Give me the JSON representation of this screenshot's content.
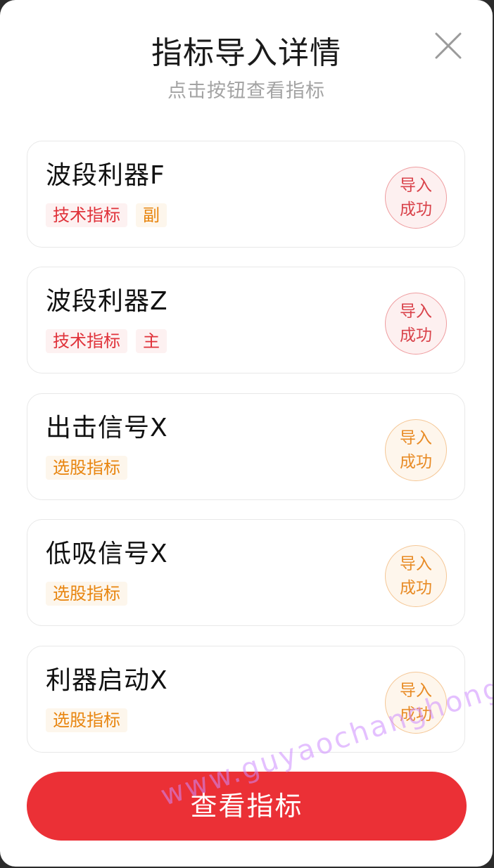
{
  "modal": {
    "title": "指标导入详情",
    "subtitle": "点击按钮查看指标"
  },
  "icons": {
    "close": "close-icon"
  },
  "colors": {
    "primary_red": "#eb3036",
    "tag_red": "#e0323a",
    "tag_orange": "#e8850f"
  },
  "indicators": [
    {
      "name": "波段利器F",
      "tags": [
        {
          "label": "技术指标",
          "tone": "red"
        },
        {
          "label": "副",
          "tone": "orange"
        }
      ],
      "status_line1": "导入",
      "status_line2": "成功",
      "status_tone": "red"
    },
    {
      "name": "波段利器Z",
      "tags": [
        {
          "label": "技术指标",
          "tone": "red"
        },
        {
          "label": "主",
          "tone": "red"
        }
      ],
      "status_line1": "导入",
      "status_line2": "成功",
      "status_tone": "red"
    },
    {
      "name": "出击信号X",
      "tags": [
        {
          "label": "选股指标",
          "tone": "orange"
        }
      ],
      "status_line1": "导入",
      "status_line2": "成功",
      "status_tone": "orange"
    },
    {
      "name": "低吸信号X",
      "tags": [
        {
          "label": "选股指标",
          "tone": "orange"
        }
      ],
      "status_line1": "导入",
      "status_line2": "成功",
      "status_tone": "orange"
    },
    {
      "name": "利器启动X",
      "tags": [
        {
          "label": "选股指标",
          "tone": "orange"
        }
      ],
      "status_line1": "导入",
      "status_line2": "成功",
      "status_tone": "orange"
    }
  ],
  "footer": {
    "view_button_label": "查看指标"
  },
  "watermark": "www.guyaochanghong.com"
}
